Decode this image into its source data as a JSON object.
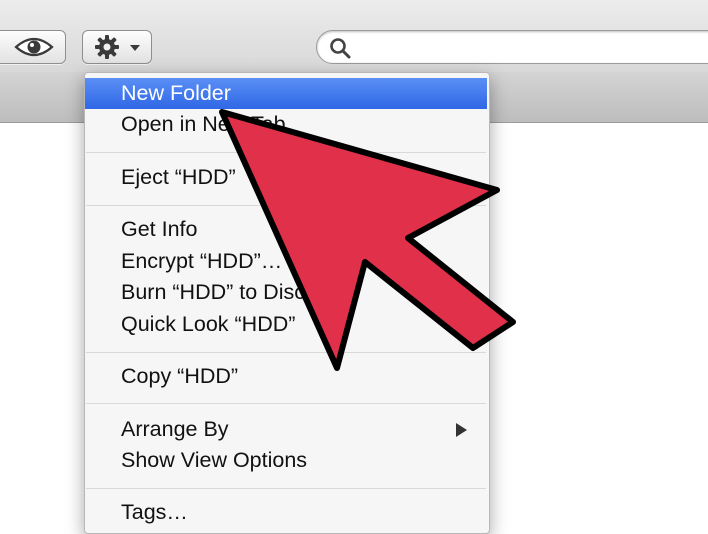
{
  "toolbar": {
    "quick_look_icon": "eye-icon",
    "action_icon": "gear-icon",
    "action_dropdown_icon": "chevron-down-icon",
    "search_icon": "magnifier-icon",
    "search_value": ""
  },
  "menu": {
    "items": [
      {
        "label": "New Folder",
        "highlighted": true
      },
      {
        "label": "Open in New Tab"
      },
      {
        "label": "Eject “HDD”"
      },
      {
        "label": "Get Info"
      },
      {
        "label": "Encrypt “HDD”…"
      },
      {
        "label": "Burn “HDD” to Disc…"
      },
      {
        "label": "Quick Look “HDD”"
      },
      {
        "label": "Copy “HDD”"
      },
      {
        "label": "Arrange By",
        "submenu": true
      },
      {
        "label": "Show View Options"
      },
      {
        "label": "Tags…"
      }
    ],
    "highlight_color": "#3f78ee"
  },
  "overlay": {
    "arrow_color": "#e0304a",
    "arrow_icon": "pointer-arrow-icon"
  }
}
